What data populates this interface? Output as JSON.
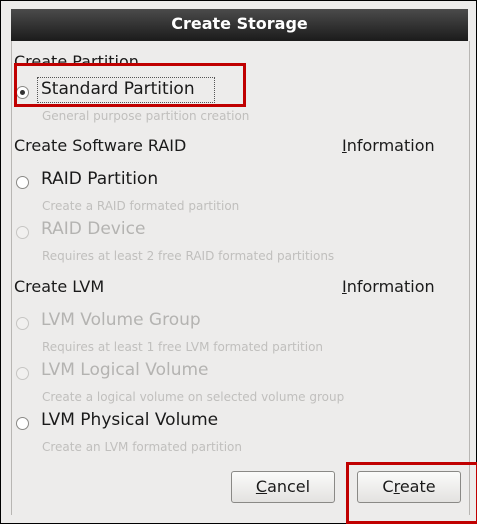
{
  "dialog": {
    "title": "Create Storage"
  },
  "sections": {
    "partition": {
      "header": "Create Partition",
      "options": [
        {
          "mnemonic": "",
          "rest": "Standard Partition",
          "description": "General purpose partition creation",
          "selected": true,
          "enabled": true
        }
      ]
    },
    "raid": {
      "header": "Create Software RAID",
      "info_mnemonic": "I",
      "info_rest": "nformation",
      "options": [
        {
          "label": "RAID Partition",
          "description": "Create a RAID formated partition",
          "selected": false,
          "enabled": true
        },
        {
          "label": "RAID Device",
          "description": "Requires at least 2 free RAID formated partitions",
          "selected": false,
          "enabled": false
        }
      ]
    },
    "lvm": {
      "header": "Create LVM",
      "info_mnemonic": "I",
      "info_rest": "nformation",
      "options": [
        {
          "label": "LVM Volume Group",
          "description": "Requires at least 1 free LVM formated partition",
          "selected": false,
          "enabled": false
        },
        {
          "label": "LVM Logical Volume",
          "description": "Create a logical volume on selected volume group",
          "selected": false,
          "enabled": false
        },
        {
          "label": "LVM Physical Volume",
          "description": "Create an LVM formated partition",
          "selected": false,
          "enabled": true
        }
      ]
    }
  },
  "buttons": {
    "cancel_mnemonic": "C",
    "cancel_rest": "ancel",
    "create_first": "C",
    "create_mnemonic": "r",
    "create_rest": "eate"
  },
  "colors": {
    "highlight": "#c00000",
    "titlebar": "#2b2b2b",
    "disabled_text": "#b4b3b1"
  }
}
